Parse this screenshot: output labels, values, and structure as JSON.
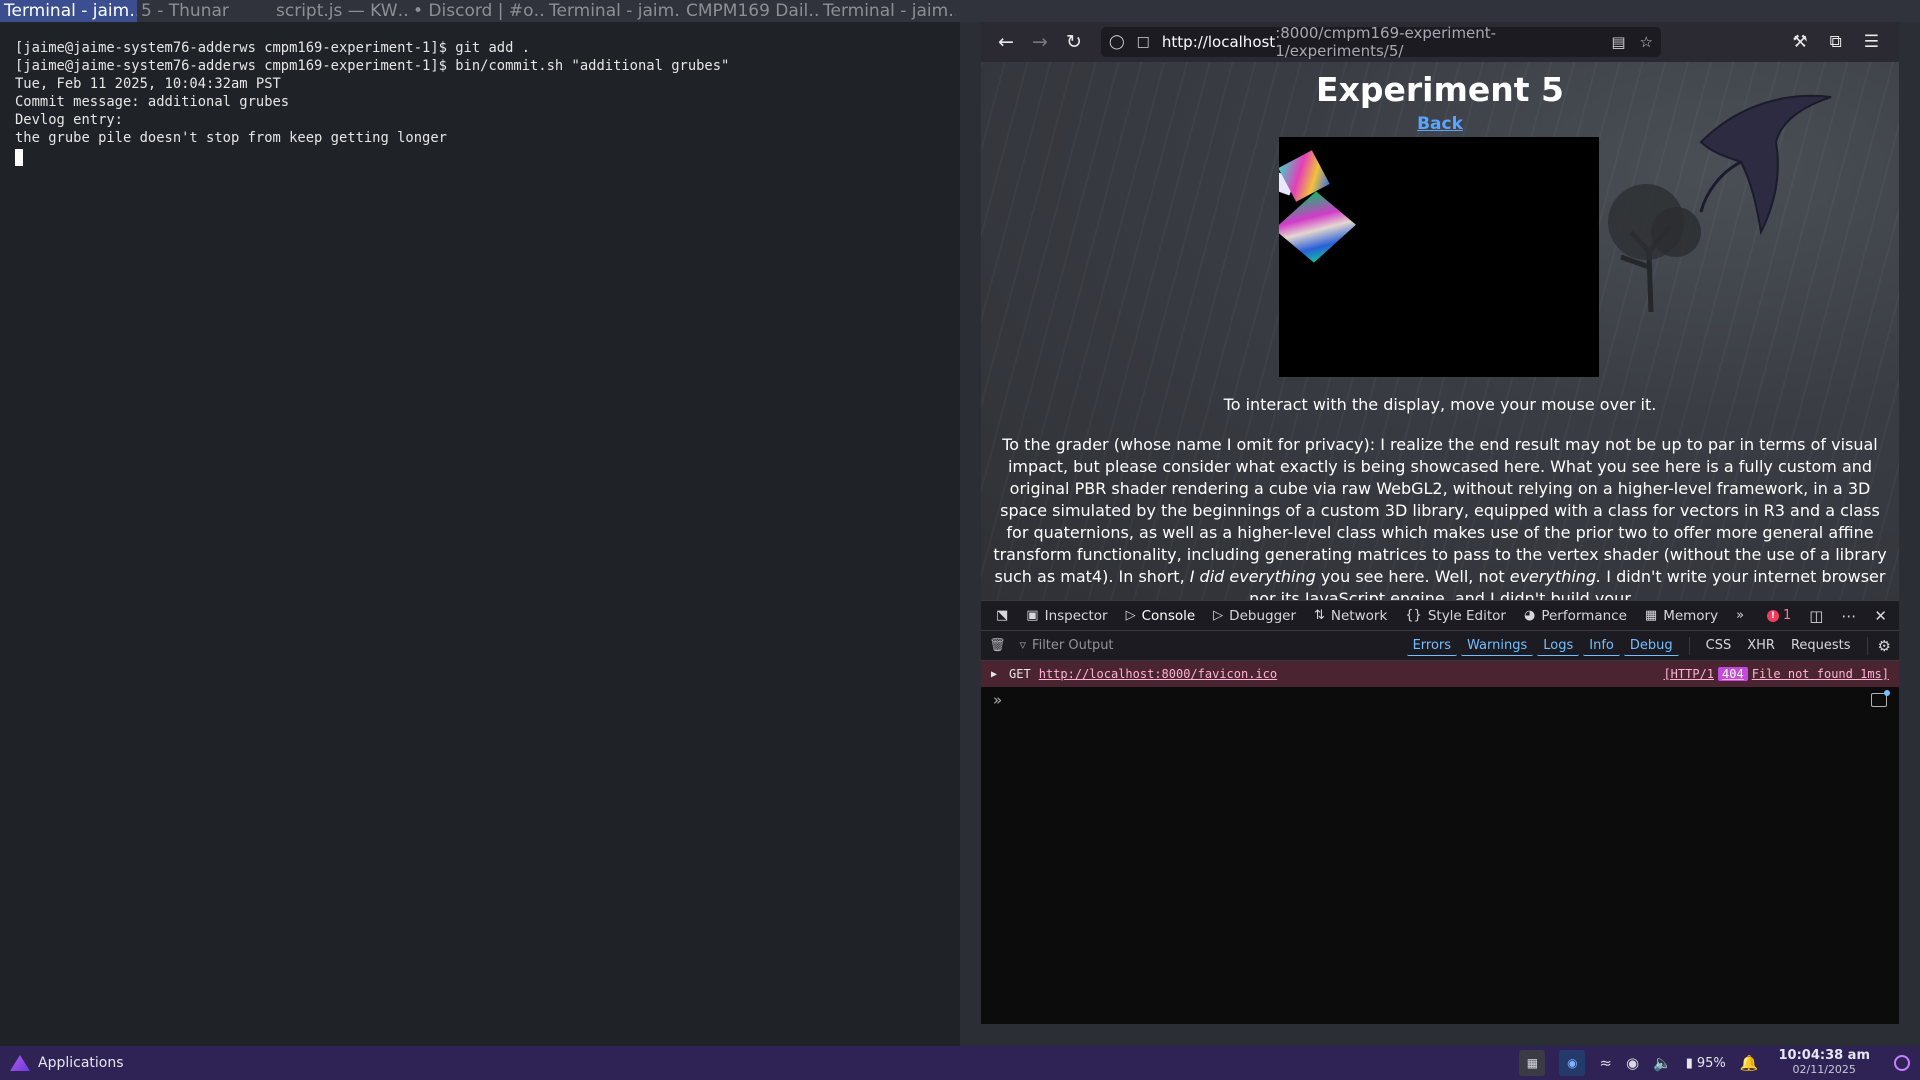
{
  "window_tabs": [
    {
      "label": "Terminal - jaim…",
      "active": true
    },
    {
      "label": "5 - Thunar",
      "active": false
    },
    {
      "label": "script.js — KW…",
      "active": false
    },
    {
      "label": "• Discord | #o…",
      "active": false
    },
    {
      "label": "Terminal - jaim…",
      "active": false
    },
    {
      "label": "CMPM169 Dail…",
      "active": false
    },
    {
      "label": "Terminal - jaim…",
      "active": false
    }
  ],
  "terminal": {
    "lines": [
      "[jaime@jaime-system76-adderws cmpm169-experiment-1]$ git add .",
      "[jaime@jaime-system76-adderws cmpm169-experiment-1]$ bin/commit.sh \"additional grubes\"",
      "Tue, Feb 11 2025, 10:04:32am PST",
      "Commit message: additional grubes",
      "Devlog entry:",
      "the grube pile doesn't stop from keep getting longer"
    ]
  },
  "browser": {
    "url_host": "http://localhost",
    "url_rest": ":8000/cmpm169-experiment-1/experiments/5/",
    "page": {
      "title": "Experiment 5",
      "back_label": "Back",
      "hint": "To interact with the display, move your mouse over it.",
      "essay_a": "To the grader (whose name I omit for privacy): I realize the end result may not be up to par in terms of visual impact, but please consider what exactly is being showcased here. What you see here is a fully custom and original PBR shader rendering a cube via raw WebGL2, without relying on a higher-level framework, in a 3D space simulated by the beginnings of a custom 3D library, equipped with a class for vectors in R3 and a class for quaternions, as well as a higher-level class which makes use of the prior two to offer more general affine transform functionality, including generating matrices to pass to the vertex shader (without the use of a library such as mat4). In short, ",
      "essay_i1": "I did everything",
      "essay_b": " you see here. Well, not ",
      "essay_i2": "everything.",
      "essay_c": " I didn't write your internet browser nor its JavaScript engine, and I didn't build your"
    },
    "devtools": {
      "tabs": [
        "Inspector",
        "Console",
        "Debugger",
        "Network",
        "Style Editor",
        "Performance",
        "Memory"
      ],
      "selected_tab": "Console",
      "error_count": "1",
      "filter_placeholder": "Filter Output",
      "levels": [
        "Errors",
        "Warnings",
        "Logs",
        "Info",
        "Debug"
      ],
      "extra_filters": [
        "CSS",
        "XHR",
        "Requests"
      ],
      "log": {
        "method": "GET",
        "url": "http://localhost:8000/favicon.ico",
        "protocol": "[HTTP/1",
        "status": "404",
        "status_text": "File not found 1ms]"
      }
    }
  },
  "taskbar": {
    "apps_label": "Applications",
    "battery": "95%",
    "time": "10:04:38 am",
    "date": "02/11/2025"
  }
}
